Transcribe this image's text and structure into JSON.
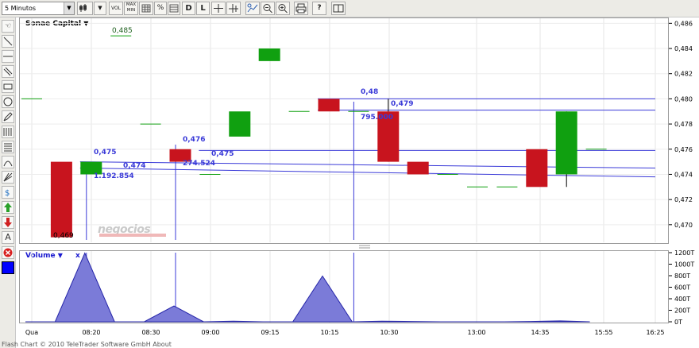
{
  "toolbar": {
    "period_select": "5 Minutos",
    "vol_button": "VOL",
    "maxmin_button_top": "MAX",
    "maxmin_button_bottom": "MIN",
    "percent_button": "%",
    "d_button": "D",
    "l_button": "L",
    "help_button": "?"
  },
  "chart": {
    "title": "Sonae Capital",
    "volume_title": "Volume",
    "volume_close": "x",
    "watermark": "negocios"
  },
  "footer": {
    "text": "Flash Chart © 2010 TeleTrader Software GmbH About"
  },
  "colors": {
    "up": "#10a010",
    "down": "#c8141e",
    "trendline": "#3a3ad8",
    "volume_fill": "#7b7bd8",
    "volume_stroke": "#2424a8"
  },
  "chart_data": [
    {
      "type": "candlestick",
      "title": "Sonae Capital",
      "y_ticks": [
        "0,470",
        "0,472",
        "0,474",
        "0,476",
        "0,478",
        "0,480",
        "0,482",
        "0,484",
        "0,486"
      ],
      "ylim": [
        0.4686,
        0.4864
      ],
      "x_ticks": [
        "Qua",
        "08:20",
        "08:30",
        "09:00",
        "09:15",
        "10:15",
        "10:30",
        "13:00",
        "14:35",
        "15:55",
        "16:25"
      ],
      "candles": [
        {
          "slot": 0,
          "o": 0.48,
          "h": 0.48,
          "l": 0.48,
          "c": 0.48
        },
        {
          "slot": 1,
          "o": 0.475,
          "h": 0.475,
          "l": 0.469,
          "c": 0.469
        },
        {
          "slot": 2,
          "o": 0.474,
          "h": 0.475,
          "l": 0.474,
          "c": 0.475
        },
        {
          "slot": 3,
          "o": 0.485,
          "h": 0.485,
          "l": 0.485,
          "c": 0.485
        },
        {
          "slot": 4,
          "o": 0.478,
          "h": 0.478,
          "l": 0.478,
          "c": 0.478
        },
        {
          "slot": 5,
          "o": 0.476,
          "h": 0.476,
          "l": 0.475,
          "c": 0.475
        },
        {
          "slot": 6,
          "o": 0.474,
          "h": 0.474,
          "l": 0.474,
          "c": 0.474
        },
        {
          "slot": 7,
          "o": 0.477,
          "h": 0.479,
          "l": 0.477,
          "c": 0.479
        },
        {
          "slot": 8,
          "o": 0.483,
          "h": 0.484,
          "l": 0.483,
          "c": 0.484
        },
        {
          "slot": 9,
          "o": 0.479,
          "h": 0.479,
          "l": 0.479,
          "c": 0.479
        },
        {
          "slot": 10,
          "o": 0.48,
          "h": 0.48,
          "l": 0.479,
          "c": 0.479
        },
        {
          "slot": 11,
          "o": 0.479,
          "h": 0.479,
          "l": 0.479,
          "c": 0.479
        },
        {
          "slot": 12,
          "o": 0.479,
          "h": 0.48,
          "l": 0.475,
          "c": 0.475
        },
        {
          "slot": 13,
          "o": 0.475,
          "h": 0.475,
          "l": 0.474,
          "c": 0.474
        },
        {
          "slot": 14,
          "o": 0.474,
          "h": 0.474,
          "l": 0.474,
          "c": 0.474
        },
        {
          "slot": 15,
          "o": 0.473,
          "h": 0.473,
          "l": 0.473,
          "c": 0.473
        },
        {
          "slot": 16,
          "o": 0.473,
          "h": 0.473,
          "l": 0.473,
          "c": 0.473
        },
        {
          "slot": 17,
          "o": 0.476,
          "h": 0.476,
          "l": 0.473,
          "c": 0.473
        },
        {
          "slot": 18,
          "o": 0.474,
          "h": 0.479,
          "l": 0.473,
          "c": 0.479
        },
        {
          "slot": 19,
          "o": 0.476,
          "h": 0.476,
          "l": 0.476,
          "c": 0.476
        }
      ],
      "value_labels": [
        "0,485",
        "0,469",
        "0,475",
        "0,474",
        "0,476",
        "0,475",
        "0,48",
        "0,479"
      ],
      "volume_labels": [
        "1.192.854",
        "274.524",
        "795.000"
      ],
      "trendlines": [
        {
          "from": [
            2,
            0.4745
          ],
          "to": [
            20,
            0.4738
          ]
        },
        {
          "from": [
            2,
            0.475
          ],
          "to": [
            20,
            0.4745
          ]
        },
        {
          "from": [
            6,
            0.4759
          ],
          "to": [
            20,
            0.4759
          ]
        },
        {
          "from": [
            10,
            0.4791
          ],
          "to": [
            20,
            0.4791
          ]
        },
        {
          "from": [
            10,
            0.48
          ],
          "to": [
            20,
            0.48
          ]
        }
      ]
    },
    {
      "type": "area",
      "title": "Volume",
      "y_ticks": [
        "0T",
        "200T",
        "400T",
        "600T",
        "800T",
        "1000T",
        "1200T"
      ],
      "ylim": [
        0,
        1200000
      ],
      "x_ticks": [
        "Qua",
        "08:20",
        "08:30",
        "09:00",
        "09:15",
        "10:15",
        "10:30",
        "13:00",
        "14:35",
        "15:55",
        "16:25"
      ],
      "points": [
        0,
        0,
        1192854,
        0,
        0,
        274524,
        0,
        10000,
        0,
        0,
        795000,
        0,
        10000,
        5000,
        0,
        0,
        0,
        5000,
        15000,
        0
      ]
    }
  ]
}
